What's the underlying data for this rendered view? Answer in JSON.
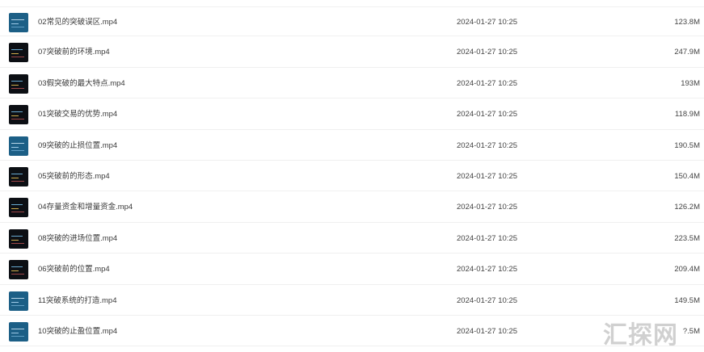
{
  "files": [
    {
      "name": "02常见的突破误区.mp4",
      "date": "2024-01-27 10:25",
      "size": "123.8M",
      "thumb": "blue"
    },
    {
      "name": "07突破前的环境.mp4",
      "date": "2024-01-27 10:25",
      "size": "247.9M",
      "thumb": "dark"
    },
    {
      "name": "03假突破的最大特点.mp4",
      "date": "2024-01-27 10:25",
      "size": "193M",
      "thumb": "dark"
    },
    {
      "name": "01突破交易的优势.mp4",
      "date": "2024-01-27 10:25",
      "size": "118.9M",
      "thumb": "dark"
    },
    {
      "name": "09突破的止损位置.mp4",
      "date": "2024-01-27 10:25",
      "size": "190.5M",
      "thumb": "blue"
    },
    {
      "name": "05突破前的形态.mp4",
      "date": "2024-01-27 10:25",
      "size": "150.4M",
      "thumb": "dark"
    },
    {
      "name": "04存量资金和增量资金.mp4",
      "date": "2024-01-27 10:25",
      "size": "126.2M",
      "thumb": "dark"
    },
    {
      "name": "08突破的进场位置.mp4",
      "date": "2024-01-27 10:25",
      "size": "223.5M",
      "thumb": "dark"
    },
    {
      "name": "06突破前的位置.mp4",
      "date": "2024-01-27 10:25",
      "size": "209.4M",
      "thumb": "dark"
    },
    {
      "name": "11突破系统的打造.mp4",
      "date": "2024-01-27 10:25",
      "size": "149.5M",
      "thumb": "blue"
    },
    {
      "name": "10突破的止盈位置.mp4",
      "date": "2024-01-27 10:25",
      "size": "?.5M",
      "thumb": "blue"
    }
  ],
  "watermark": "汇探网"
}
